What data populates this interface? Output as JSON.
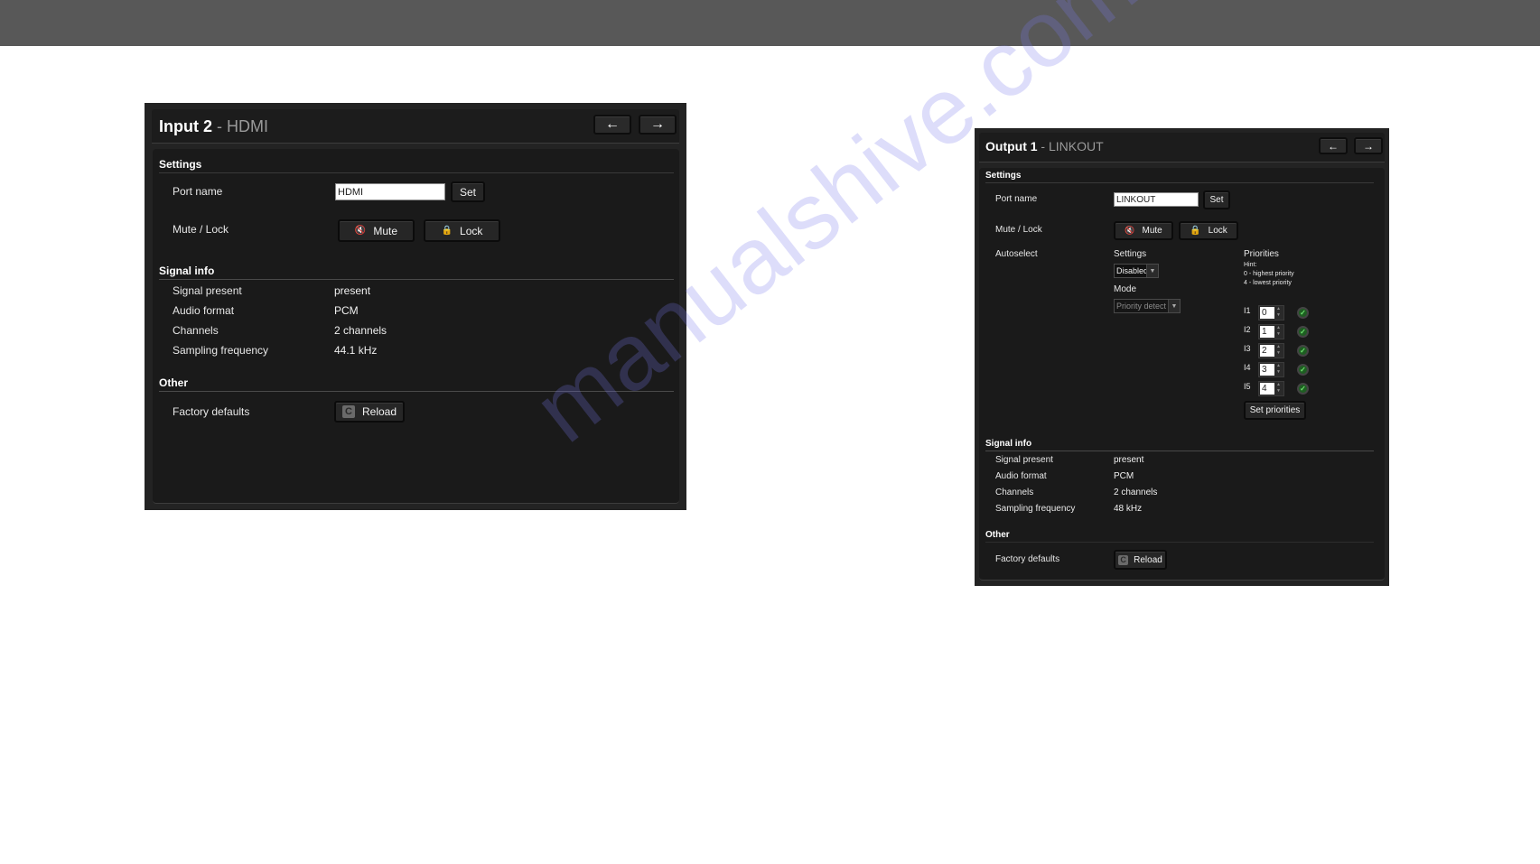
{
  "topbar": {
    "color": "#585858"
  },
  "panel_input": {
    "title_strong": "Input 2",
    "title_sep": " - ",
    "title_name": "HDMI",
    "nav": {
      "prev_icon": "arrow-left-icon",
      "next_icon": "arrow-right-icon",
      "prev_glyph": "🡐",
      "next_glyph": "🡒"
    },
    "settings": {
      "heading": "Settings",
      "port_name_label": "Port name",
      "port_name_value": "HDMI",
      "set_label": "Set",
      "mute_lock_label": "Mute / Lock",
      "mute_label": "Mute",
      "lock_label": "Lock",
      "mute_icon": "speaker-mute-icon",
      "lock_icon": "padlock-icon"
    },
    "signal_info": {
      "heading": "Signal info",
      "rows": [
        {
          "label": "Signal present",
          "value": "present"
        },
        {
          "label": "Audio format",
          "value": "PCM"
        },
        {
          "label": "Channels",
          "value": "2 channels"
        },
        {
          "label": "Sampling frequency",
          "value": "44.1 kHz"
        }
      ]
    },
    "other": {
      "heading": "Other",
      "factory_label": "Factory defaults",
      "reload_label": "Reload",
      "reload_icon": "reload-icon"
    }
  },
  "panel_output": {
    "title_strong": "Output 1",
    "title_sep": " - ",
    "title_name": "LINKOUT",
    "settings": {
      "heading": "Settings",
      "port_name_label": "Port name",
      "port_name_value": "LINKOUT",
      "set_label": "Set",
      "mute_lock_label": "Mute / Lock",
      "mute_label": "Mute",
      "lock_label": "Lock",
      "autoselect_label": "Autoselect",
      "autoselect_settings_label": "Settings",
      "autoselect_settings_value": "Disabled",
      "mode_label": "Mode",
      "mode_value": "Priority detect",
      "priorities_label": "Priorities",
      "hint_title": "Hint:",
      "hint_line1": "0 - highest priority",
      "hint_line2": "4 - lowest priority",
      "priorities": [
        {
          "input": "I1",
          "value": "0",
          "status": "ok"
        },
        {
          "input": "I2",
          "value": "1",
          "status": "ok"
        },
        {
          "input": "I3",
          "value": "2",
          "status": "ok"
        },
        {
          "input": "I4",
          "value": "3",
          "status": "ok"
        },
        {
          "input": "I5",
          "value": "4",
          "status": "ok"
        }
      ],
      "set_priorities_label": "Set priorities"
    },
    "signal_info": {
      "heading": "Signal info",
      "rows": [
        {
          "label": "Signal present",
          "value": "present"
        },
        {
          "label": "Audio format",
          "value": "PCM"
        },
        {
          "label": "Channels",
          "value": "2 channels"
        },
        {
          "label": "Sampling frequency",
          "value": "48 kHz"
        }
      ]
    },
    "other": {
      "heading": "Other",
      "factory_label": "Factory defaults",
      "reload_label": "Reload"
    }
  },
  "watermark": "manualshive.com"
}
